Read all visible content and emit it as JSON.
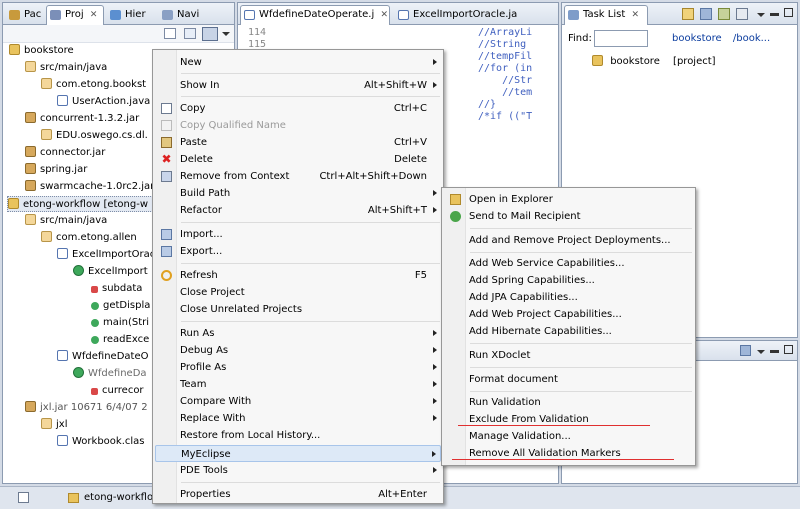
{
  "left_panel": {
    "tabs": [
      {
        "label": "Pac"
      },
      {
        "label": "Proj",
        "close": "✕"
      },
      {
        "label": "Hier"
      },
      {
        "label": "Navi"
      }
    ],
    "tree": [
      {
        "label": "bookstore"
      },
      {
        "label": "src/main/java"
      },
      {
        "label": "com.etong.bookst"
      },
      {
        "label": "UserAction.java"
      },
      {
        "label": "concurrent-1.3.2.jar"
      },
      {
        "label": "EDU.oswego.cs.dl."
      },
      {
        "label": "connector.jar"
      },
      {
        "label": "spring.jar"
      },
      {
        "label": "swarmcache-1.0rc2.jar"
      },
      {
        "label": "etong-workflow [etong-w"
      },
      {
        "label": "src/main/java"
      },
      {
        "label": "com.etong.allen"
      },
      {
        "label": "ExcelImportOracl"
      },
      {
        "label": "ExcelImport"
      },
      {
        "label": "subdata"
      },
      {
        "label": "getDispla"
      },
      {
        "label": "main(Stri"
      },
      {
        "label": "readExce"
      },
      {
        "label": "WfdefineDateO"
      },
      {
        "label": "WfdefineDa"
      },
      {
        "label": "currecor"
      },
      {
        "label": "jxl.jar 10671  6/4/07 2"
      },
      {
        "label": "jxl"
      },
      {
        "label": "Workbook.clas"
      }
    ]
  },
  "editor": {
    "tabs": [
      {
        "label": "WfdefineDateOperate.j",
        "close": "✕"
      },
      {
        "label": "ExcelImportOracle.ja"
      }
    ],
    "line_numbers": [
      "114",
      "115"
    ],
    "code_lines": [
      "//ArrayLi",
      "//String ",
      "//tempFil",
      "//for (in",
      "    //Str",
      "    //tem",
      "//}",
      "/*if ((\"T"
    ]
  },
  "task_list": {
    "tab_label": "Task List",
    "close": "✕",
    "find_label": "Find:",
    "find_value": "",
    "breadcrumb_root": "bookstore",
    "breadcrumb_more": "/book...",
    "row_name": "bookstore",
    "row_type": "[project]"
  },
  "context_menu": {
    "items": [
      {
        "label": "New",
        "shortcut": "",
        "submenu": true
      },
      {
        "label": "Show In",
        "shortcut": "Alt+Shift+W",
        "submenu": true
      },
      {
        "label": "Copy",
        "shortcut": "Ctrl+C"
      },
      {
        "label": "Copy Qualified Name",
        "shortcut": "",
        "disabled": true
      },
      {
        "label": "Paste",
        "shortcut": "Ctrl+V"
      },
      {
        "label": "Delete",
        "shortcut": "Delete"
      },
      {
        "label": "Remove from Context",
        "shortcut": "Ctrl+Alt+Shift+Down"
      },
      {
        "label": "Build Path",
        "shortcut": "",
        "submenu": true
      },
      {
        "label": "Refactor",
        "shortcut": "Alt+Shift+T",
        "submenu": true
      },
      {
        "label": "Import...",
        "shortcut": ""
      },
      {
        "label": "Export...",
        "shortcut": ""
      },
      {
        "label": "Refresh",
        "shortcut": "F5"
      },
      {
        "label": "Close Project",
        "shortcut": ""
      },
      {
        "label": "Close Unrelated Projects",
        "shortcut": ""
      },
      {
        "label": "Run As",
        "shortcut": "",
        "submenu": true
      },
      {
        "label": "Debug As",
        "shortcut": "",
        "submenu": true
      },
      {
        "label": "Profile As",
        "shortcut": "",
        "submenu": true
      },
      {
        "label": "Team",
        "shortcut": "",
        "submenu": true
      },
      {
        "label": "Compare With",
        "shortcut": "",
        "submenu": true
      },
      {
        "label": "Replace With",
        "shortcut": "",
        "submenu": true
      },
      {
        "label": "Restore from Local History...",
        "shortcut": ""
      },
      {
        "label": "MyEclipse",
        "shortcut": "",
        "submenu": true,
        "highlighted": true
      },
      {
        "label": "PDE Tools",
        "shortcut": "",
        "submenu": true
      },
      {
        "label": "Properties",
        "shortcut": "Alt+Enter"
      }
    ]
  },
  "submenu": {
    "items": [
      {
        "label": "Open in Explorer"
      },
      {
        "label": "Send to Mail Recipient"
      },
      {
        "label": "Add and Remove Project Deployments..."
      },
      {
        "label": "Add Web Service Capabilities..."
      },
      {
        "label": "Add Spring Capabilities..."
      },
      {
        "label": "Add JPA Capabilities..."
      },
      {
        "label": "Add Web Project Capabilities..."
      },
      {
        "label": "Add Hibernate Capabilities..."
      },
      {
        "label": "Run XDoclet"
      },
      {
        "label": "Format document"
      },
      {
        "label": "Run Validation"
      },
      {
        "label": "Exclude From Validation"
      },
      {
        "label": "Manage Validation..."
      },
      {
        "label": "Remove All Validation Markers"
      }
    ]
  },
  "status_bar": {
    "project": "etong-workflow"
  },
  "colors": {
    "annotation_underline": "#e03030",
    "menu_highlight": "#dde9f7"
  }
}
